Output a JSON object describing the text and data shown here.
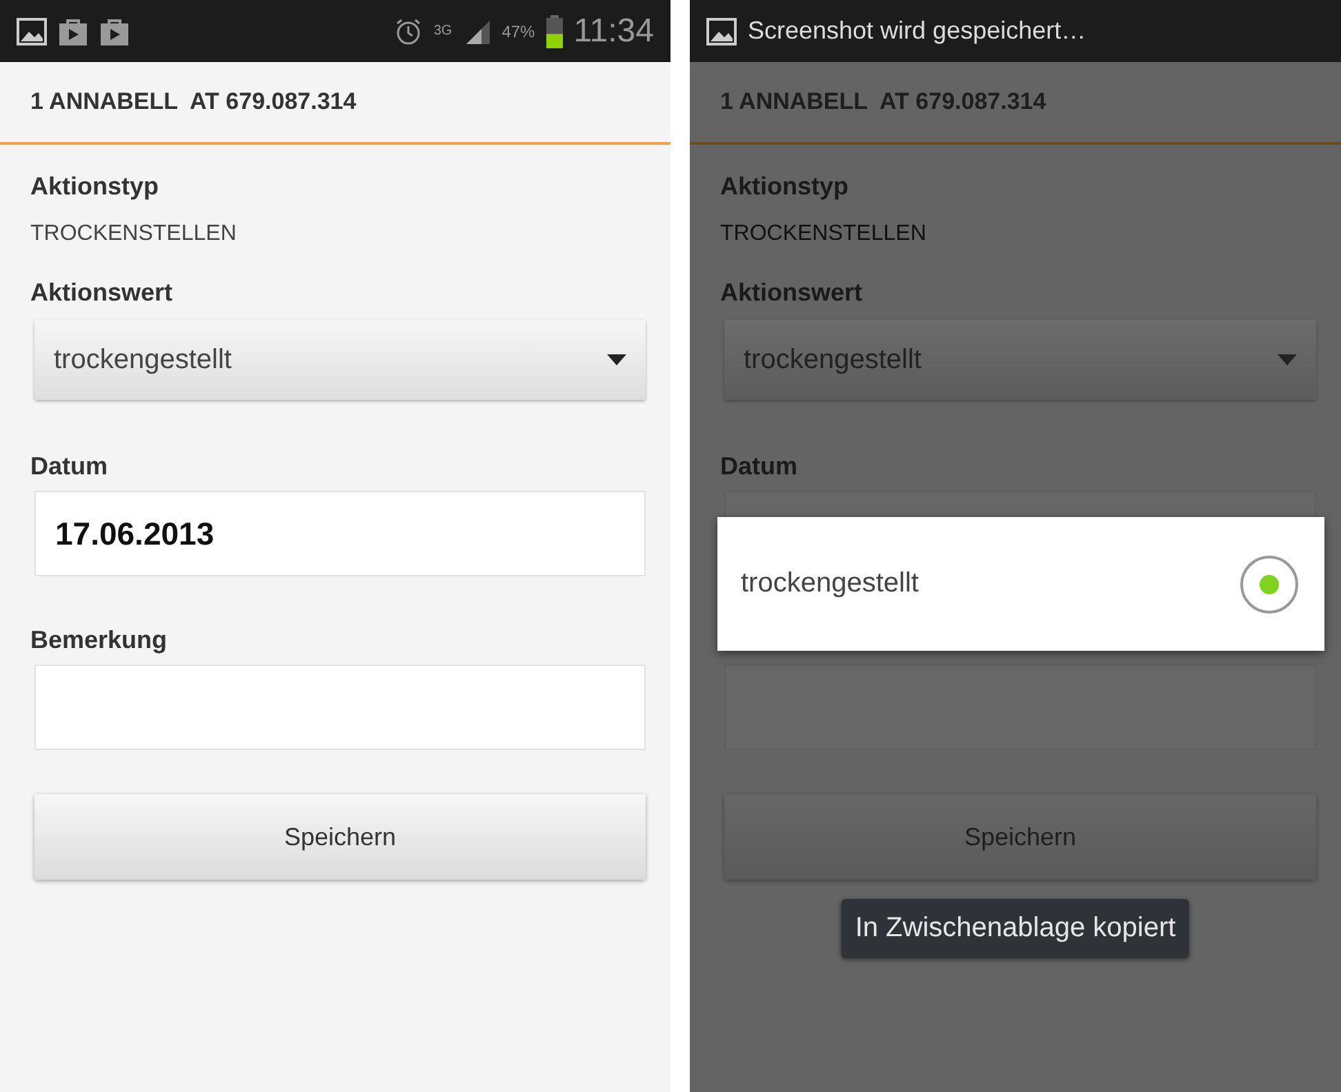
{
  "screens": [
    {
      "dimmed": false,
      "status_bar": {
        "kind": "icons",
        "network": "3G",
        "battery": {
          "label": "47%",
          "level": 0.47
        },
        "time": "11:34"
      },
      "header": "1 ANNABELL  AT 679.087.314",
      "fields": [
        {
          "kind": "static",
          "label": "Aktionstyp",
          "value": "TROCKENSTELLEN"
        },
        {
          "kind": "dropdown",
          "label": "Aktionswert",
          "value": "trockengestellt"
        },
        {
          "kind": "text",
          "label": "Datum",
          "value": "17.06.2013"
        },
        {
          "kind": "text",
          "label": "Bemerkung"
        }
      ],
      "button": "Speichern"
    },
    {
      "dimmed": true,
      "status_bar": {
        "kind": "notification",
        "text": "Screenshot wird gespeichert…"
      },
      "header": "1 ANNABELL  AT 679.087.314",
      "fields": [
        {
          "kind": "static",
          "label": "Aktionstyp",
          "value": "TROCKENSTELLEN"
        },
        {
          "kind": "dropdown",
          "label": "Aktionswert",
          "value": "trockengestellt"
        },
        {
          "kind": "text",
          "label": "Datum"
        },
        {
          "kind": "text"
        }
      ],
      "button": "Speichern",
      "dialog": {
        "options": [
          {
            "label": "trockengestellt",
            "selected": true
          }
        ]
      },
      "toast": "In Zwischenablage kopiert"
    }
  ]
}
